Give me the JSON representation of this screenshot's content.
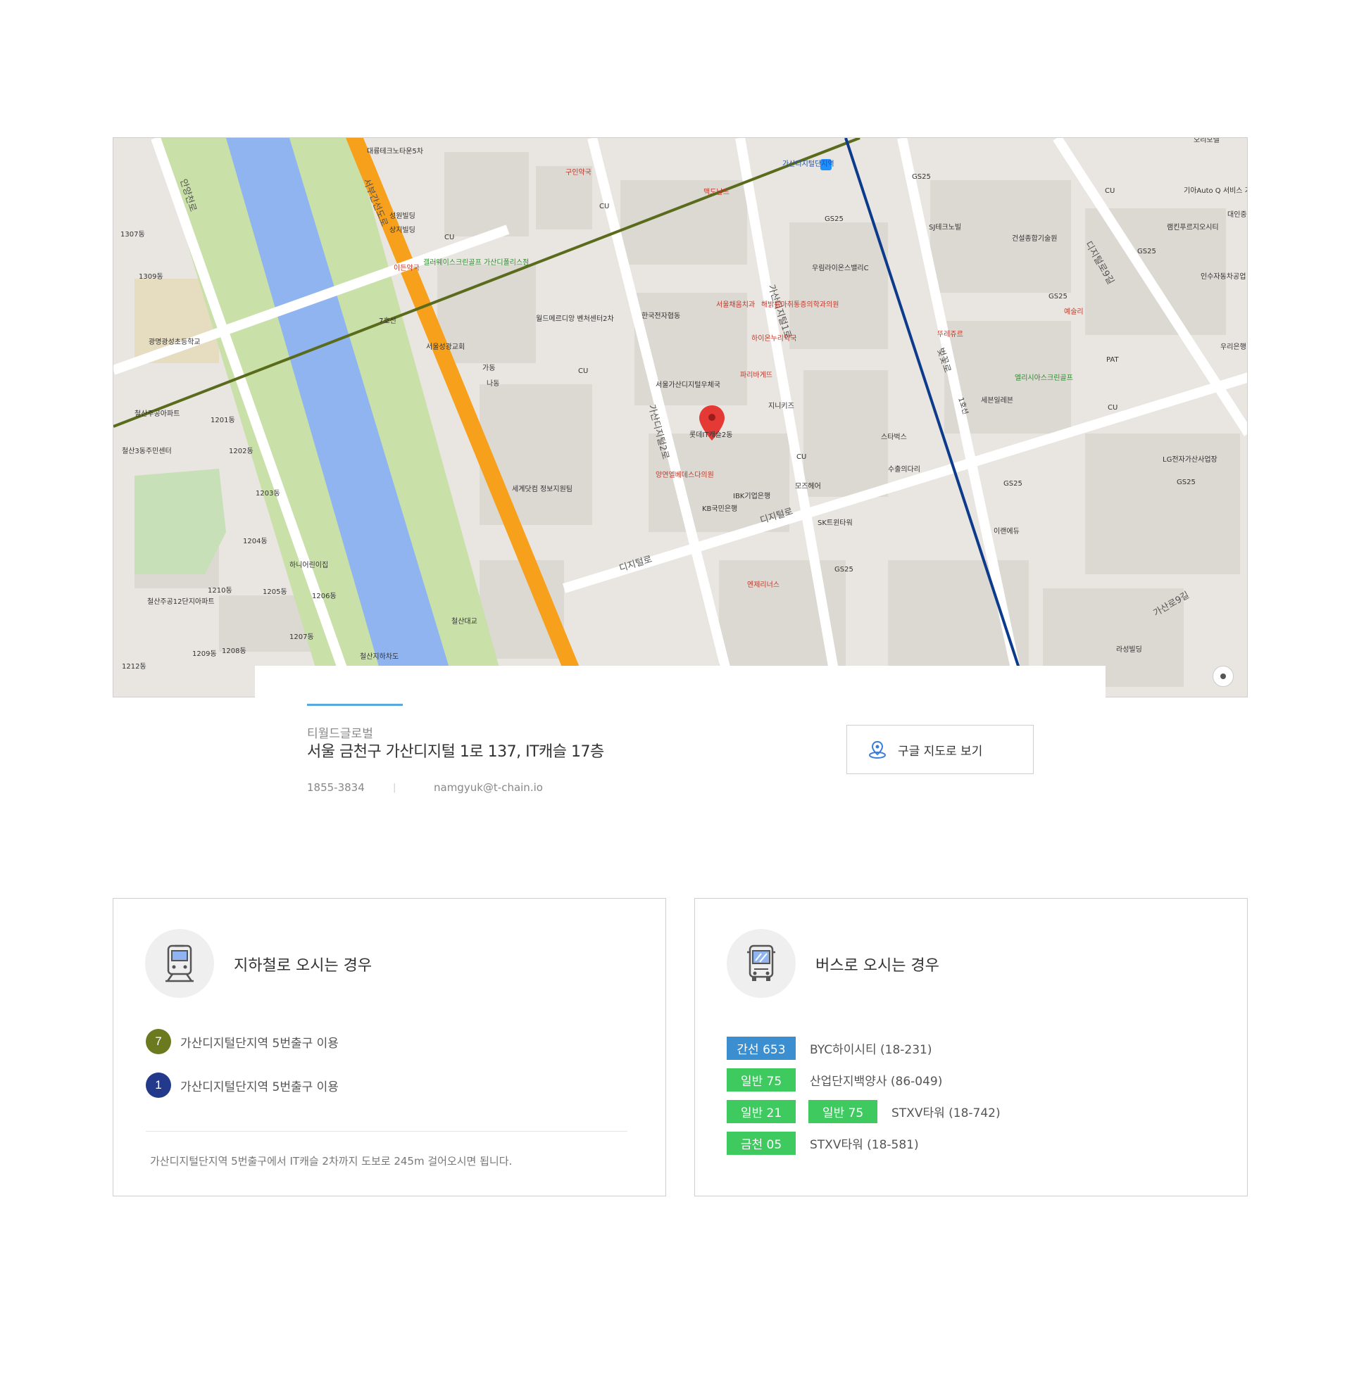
{
  "map": {
    "labels": {
      "station": "가산디지털단지역",
      "marker_building": "롯데IT캐슬2동",
      "road_gasan1": "가산디지털1로",
      "road_gasan2": "가산디지털2로",
      "road_digital": "디지털로",
      "road_seobu": "서부간선도로",
      "road_anyang": "안양천로",
      "road_beotkkot": "벚꽃로",
      "road_gasan9": "가산로9길",
      "road_digital9": "디지털로9길",
      "line7": "7호선",
      "line1": "1호선",
      "school": "광명광성초등학교",
      "bridge": "철산대교",
      "post_office": "서울가산디지털우체국",
      "starbucks": "스타벅스",
      "cu": "CU",
      "gs25": "GS25",
      "ibk": "IBK기업은행",
      "kb": "KB국민은행",
      "sk_tower": "SK트윈타워",
      "world_meridian": "월드메르디앙 벤처센터2차",
      "jihae": "지니키즈",
      "paris": "파리바게뜨",
      "hospital": "해밝음마취통증의학과의원",
      "dental": "서울채움치과",
      "pharmacy": "하이온누리약국",
      "sejong": "세계닷컴 정보지원팀",
      "woorim": "우림라이온스밸리C",
      "sj": "SJ테크노빌",
      "lg": "LG전자가산사업장",
      "eliesia": "엘리시아스크린골프",
      "sebon": "세븐일레븐",
      "gas_bridge": "수출의다리",
      "cheolsan": "철산지하차도",
      "mcd": "맥도날드",
      "church": "서울성광교회",
      "golf_w": "갤러웨이스크린골프 가산디폴리스점",
      "hanil": "한국전자협동",
      "omega": "엔제리너스",
      "mojo": "모즈헤어",
      "eulji": "이든약국",
      "apt_a": "철산주공아파트",
      "apt_b": "철산주공12단지아파트",
      "center": "철산3동주민센터",
      "hani": "하니어린이집",
      "ireume": "이랜에듀",
      "bldg_1307": "1307동",
      "bldg_1309": "1309동",
      "bldg_1201": "1201동",
      "bldg_1202": "1202동",
      "bldg_1203": "1203동",
      "bldg_1204": "1204동",
      "bldg_1205": "1205동",
      "bldg_1206": "1206동",
      "bldg_1207": "1207동",
      "bldg_1208": "1208동",
      "bldg_1209": "1209동",
      "bldg_1210": "1210동",
      "bldg_1212": "1212동",
      "daerung": "대륭테크노타운5차",
      "seongwon": "성원빌딩",
      "sangji": "상지빌딩",
      "kuin": "구인약국",
      "gundae": "가동",
      "nadong": "나동",
      "yangyeon": "양연엘베데스다의원",
      "ttureju": "뚜레쥬르",
      "pat": "PAT",
      "yesul": "예술리",
      "geonseol": "건설종합기술원",
      "kia": "기아Auto Q 서비스 가리봉점",
      "daein": "대인중",
      "raem": "램킨푸르지오시티",
      "insu": "인수자동차공업",
      "woori": "우리은행",
      "raseong": "라성빌딩",
      "orangen": "오리모텔",
      "paris2": "파리바게뜨"
    },
    "line_colors": {
      "line7": "#5b6b1c",
      "line1": "#0d3b8c",
      "highway": "#f7a01c",
      "river": "#8fb4f0"
    }
  },
  "info": {
    "company": "티월드글로벌",
    "address": "서울 금천구 가산디지털 1로 137, IT캐슬 17층",
    "phone": "1855-3834",
    "separator": "|",
    "email": "namgyuk@t-chain.io",
    "google_map_button": "구글 지도로 보기",
    "icons": {
      "google_map_button": "map-pin-icon"
    }
  },
  "subway": {
    "title": "지하철로 오시는 경우",
    "icon": "subway-icon",
    "lines": [
      {
        "number": "7",
        "text": "가산디지털단지역 5번출구 이용",
        "color": "#6b7a1f"
      },
      {
        "number": "1",
        "text": "가산디지털단지역 5번출구 이용",
        "color": "#233a8c"
      }
    ],
    "note": "가산디지털단지역 5번출구에서 IT캐슬 2차까지 도보로 245m 걸어오시면 됩니다."
  },
  "bus": {
    "title": "버스로 오시는 경우",
    "icon": "bus-icon",
    "rows": [
      {
        "badges": [
          {
            "label": "간선 653",
            "color": "#3b8fd1"
          }
        ],
        "text": "BYC하이시티 (18-231)"
      },
      {
        "badges": [
          {
            "label": "일반 75",
            "color": "#3fca60"
          }
        ],
        "text": "산업단지백양사 (86-049)"
      },
      {
        "badges": [
          {
            "label": "일반 21",
            "color": "#3fca60"
          },
          {
            "label": "일반 75",
            "color": "#3fca60"
          }
        ],
        "text": "STXV타워 (18-742)"
      },
      {
        "badges": [
          {
            "label": "금천 05",
            "color": "#3fca60"
          }
        ],
        "text": "STXV타워 (18-581)"
      }
    ]
  }
}
